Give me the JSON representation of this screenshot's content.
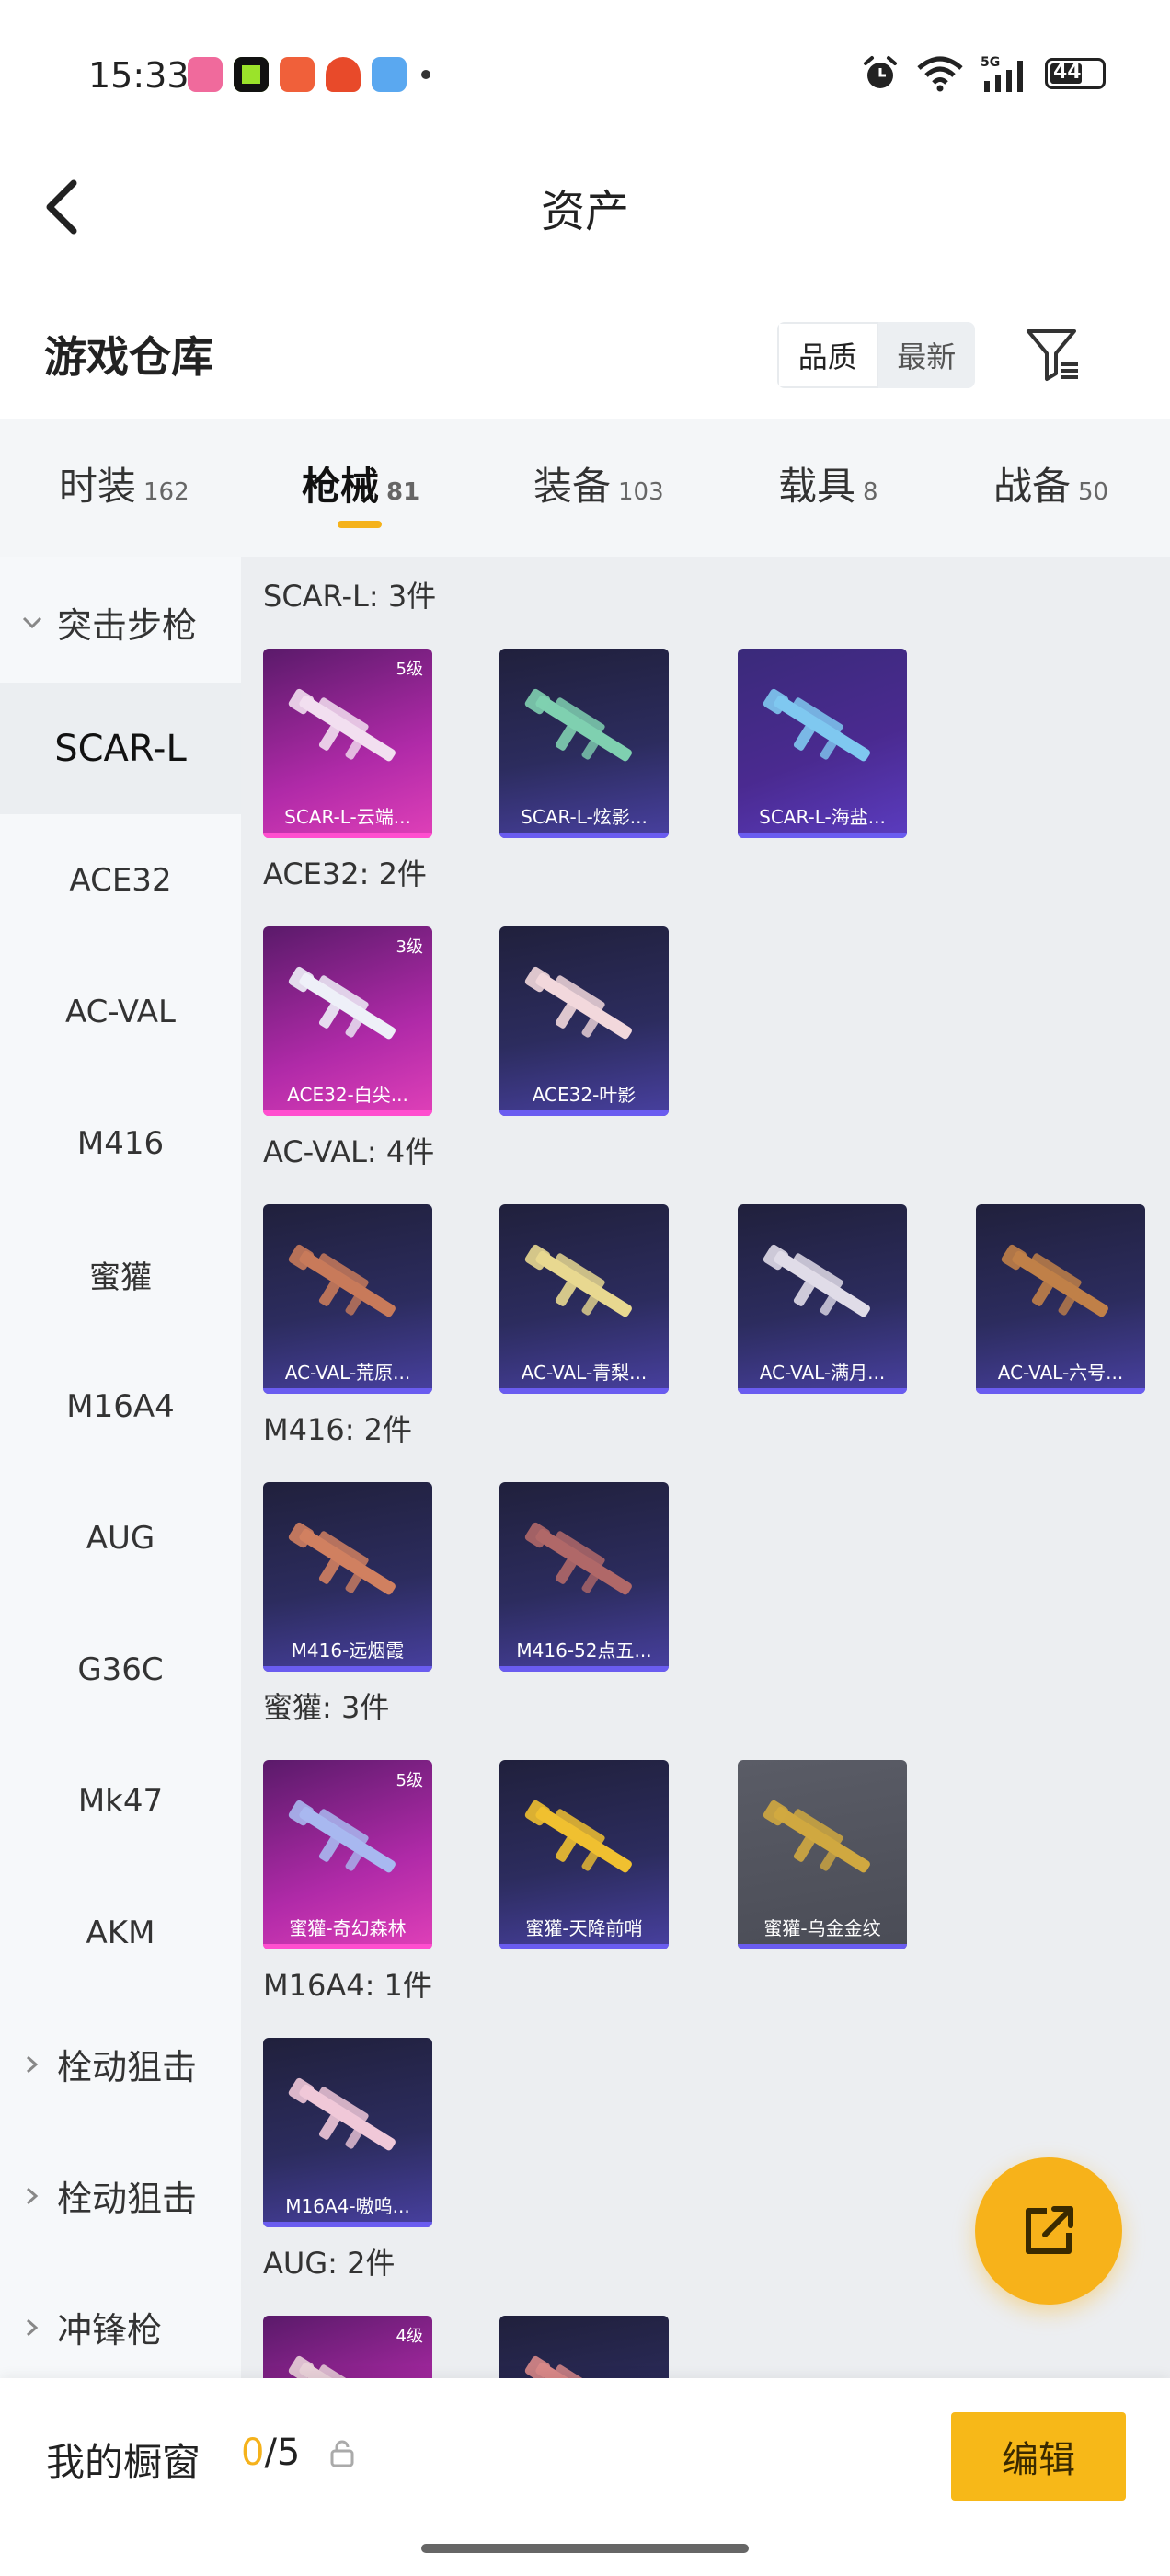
{
  "status_bar": {
    "time": "15:33",
    "notification_icons": [
      {
        "name": "bilibili-icon",
        "color": "#f06a9c"
      },
      {
        "name": "app-green-icon",
        "color": "#111111"
      },
      {
        "name": "app-orange-icon",
        "color": "#f0603a"
      },
      {
        "name": "app-red-icon",
        "color": "#e84a2a"
      },
      {
        "name": "weather-icon",
        "color": "#5aa8f0"
      }
    ],
    "battery": "44"
  },
  "header": {
    "title": "资产"
  },
  "section": {
    "title": "游戏仓库",
    "sort_options": [
      "品质",
      "最新"
    ],
    "active_sort": 0
  },
  "category_tabs": [
    {
      "label": "时装",
      "count": "162"
    },
    {
      "label": "枪械",
      "count": "81",
      "active": true
    },
    {
      "label": "装备",
      "count": "103"
    },
    {
      "label": "载具",
      "count": "8"
    },
    {
      "label": "战备",
      "count": "50"
    }
  ],
  "sidebar": {
    "items": [
      {
        "label": "突击步枪",
        "type": "group",
        "expanded": true
      },
      {
        "label": "SCAR-L",
        "type": "item",
        "active": true
      },
      {
        "label": "ACE32",
        "type": "item"
      },
      {
        "label": "AC-VAL",
        "type": "item"
      },
      {
        "label": "M416",
        "type": "item"
      },
      {
        "label": "蜜獾",
        "type": "item"
      },
      {
        "label": "M16A4",
        "type": "item"
      },
      {
        "label": "AUG",
        "type": "item"
      },
      {
        "label": "G36C",
        "type": "item"
      },
      {
        "label": "Mk47",
        "type": "item"
      },
      {
        "label": "AKM",
        "type": "item"
      },
      {
        "label": "栓动狙击",
        "type": "group",
        "expanded": false
      },
      {
        "label": "栓动狙击",
        "type": "group",
        "expanded": false
      },
      {
        "label": "冲锋枪",
        "type": "group",
        "expanded": false
      }
    ]
  },
  "groups": [
    {
      "label": "SCAR-L: 3件",
      "cards": [
        {
          "name": "SCAR-L-云端...",
          "level": "5级",
          "style": "purple-pink",
          "gun_color": "#f2dff0"
        },
        {
          "name": "SCAR-L-炫影...",
          "level": "",
          "style": "blue",
          "gun_color": "#7fd0b0"
        },
        {
          "name": "SCAR-L-海盐...",
          "level": "",
          "style": "gold",
          "gun_color": "#7fc8f0"
        }
      ]
    },
    {
      "label": "ACE32: 2件",
      "cards": [
        {
          "name": "ACE32-白尖...",
          "level": "3级",
          "style": "purple-pink",
          "gun_color": "#eef0f8"
        },
        {
          "name": "ACE32-叶影",
          "level": "",
          "style": "blue",
          "gun_color": "#f2d8dc"
        }
      ]
    },
    {
      "label": "AC-VAL: 4件",
      "cards": [
        {
          "name": "AC-VAL-荒原...",
          "level": "",
          "style": "blue",
          "gun_color": "#c87a5a"
        },
        {
          "name": "AC-VAL-青梨...",
          "level": "",
          "style": "blue",
          "gun_color": "#e8d890"
        },
        {
          "name": "AC-VAL-满月...",
          "level": "",
          "style": "blue",
          "gun_color": "#e0dce8"
        },
        {
          "name": "AC-VAL-六号...",
          "level": "",
          "style": "blue",
          "gun_color": "#c08048"
        }
      ]
    },
    {
      "label": "M416: 2件",
      "cards": [
        {
          "name": "M416-远烟霞",
          "level": "",
          "style": "blue",
          "gun_color": "#d08060"
        },
        {
          "name": "M416-52点五...",
          "level": "",
          "style": "blue",
          "gun_color": "#b06868"
        }
      ]
    },
    {
      "label": "蜜獾: 3件",
      "cards": [
        {
          "name": "蜜獾-奇幻森林",
          "level": "5级",
          "style": "purple-pink",
          "gun_color": "#a8b8f0"
        },
        {
          "name": "蜜獾-天降前哨",
          "level": "",
          "style": "blue",
          "gun_color": "#f0c030"
        },
        {
          "name": "蜜獾-乌金金纹",
          "level": "",
          "style": "gray",
          "gun_color": "#d0a840"
        }
      ]
    },
    {
      "label": "M16A4: 1件",
      "cards": [
        {
          "name": "M16A4-嗷呜...",
          "level": "",
          "style": "blue",
          "gun_color": "#f0c8d8"
        }
      ]
    },
    {
      "label": "AUG: 2件",
      "cards": [
        {
          "name": "",
          "level": "4级",
          "style": "purple-pink",
          "gun_color": "#e8d0d8"
        },
        {
          "name": "",
          "level": "",
          "style": "blue",
          "gun_color": "#d88888"
        }
      ]
    }
  ],
  "bottom_bar": {
    "showcase_label": "我的橱窗",
    "showcase_current": "0",
    "showcase_total": "/5",
    "edit_label": "编辑"
  },
  "colors": {
    "accent": "#f7b21a",
    "sidebar_bg": "#f6f8fa",
    "content_bg": "#eceef1"
  }
}
